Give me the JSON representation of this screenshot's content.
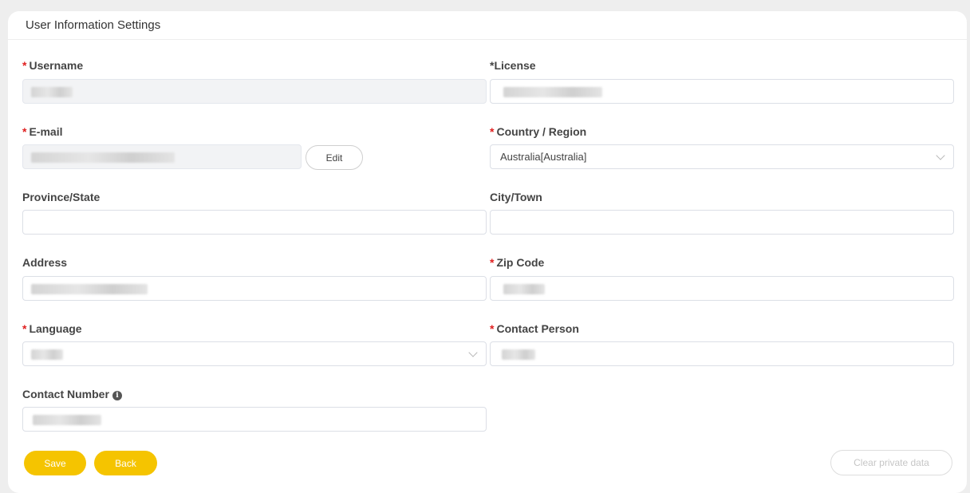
{
  "card": {
    "title": "User Information Settings"
  },
  "required_mark": "*",
  "fields": {
    "username": {
      "label": "Username",
      "required": true
    },
    "license": {
      "label": "*License"
    },
    "email": {
      "label": "E-mail",
      "required": true,
      "edit_label": "Edit"
    },
    "country": {
      "label": "Country / Region",
      "required": true,
      "value": "Australia[Australia]"
    },
    "province": {
      "label": "Province/State",
      "value": ""
    },
    "city": {
      "label": "City/Town",
      "value": ""
    },
    "address": {
      "label": "Address"
    },
    "zip": {
      "label": "Zip Code",
      "required": true
    },
    "language": {
      "label": "Language",
      "required": true
    },
    "contact_person": {
      "label": "Contact Person",
      "required": true
    },
    "contact_number": {
      "label": "Contact Number",
      "info_icon": "info-circle-icon"
    }
  },
  "actions": {
    "save_label": "Save",
    "back_label": "Back",
    "clear_label": "Clear private data"
  },
  "colors": {
    "accent": "#f5c400",
    "required": "#e02020",
    "disabled_bg": "#f2f3f5"
  }
}
